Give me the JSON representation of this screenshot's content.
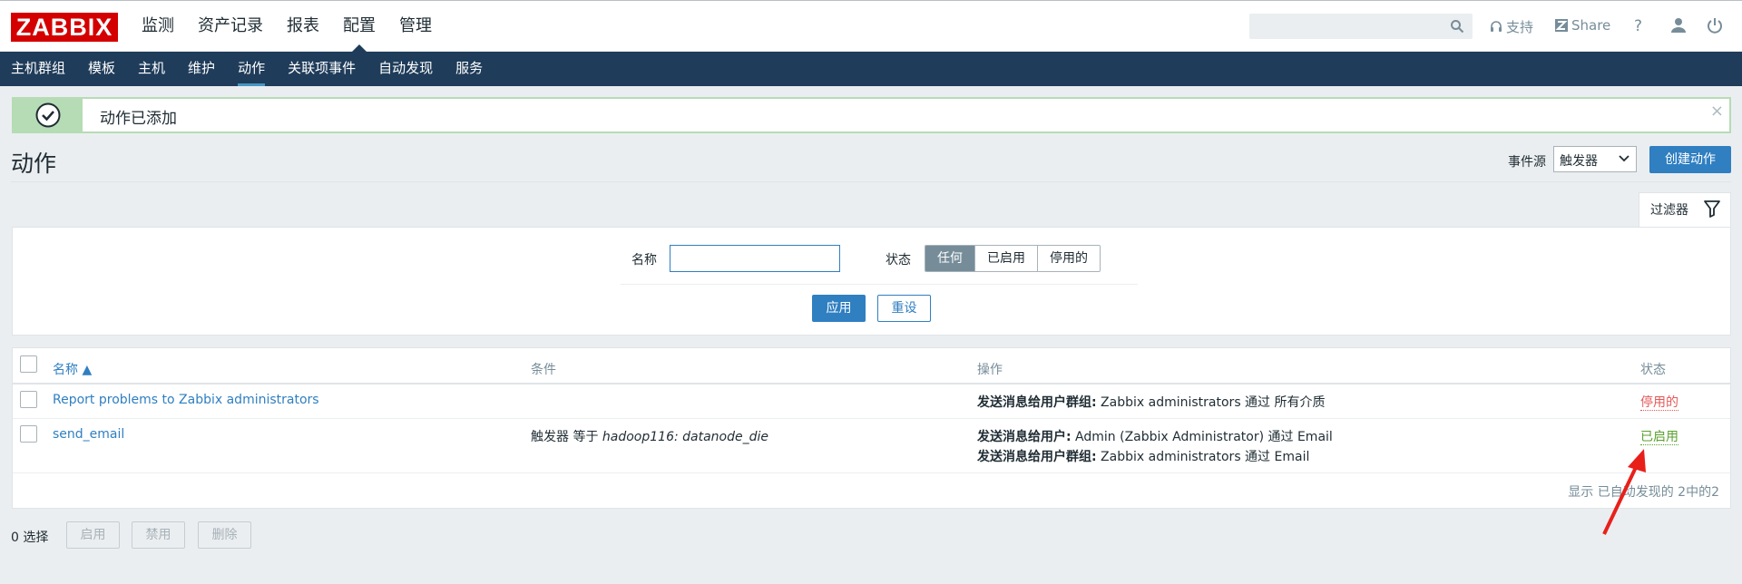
{
  "logo": "ZABBIX",
  "main_menu": [
    "监测",
    "资产记录",
    "报表",
    "配置",
    "管理"
  ],
  "main_menu_active": "配置",
  "header_links": {
    "support": "支持",
    "share": "Share",
    "help": "?"
  },
  "sub_menu": [
    "主机群组",
    "模板",
    "主机",
    "维护",
    "动作",
    "关联项事件",
    "自动发现",
    "服务"
  ],
  "sub_menu_active": "动作",
  "message": {
    "text": "动作已添加",
    "close": "×"
  },
  "page": {
    "title": "动作",
    "event_source_label": "事件源",
    "event_source_value": "触发器",
    "create_button": "创建动作"
  },
  "filter": {
    "tab_label": "过滤器",
    "name_label": "名称",
    "name_value": "",
    "status_label": "状态",
    "status_options": [
      "任何",
      "已启用",
      "停用的"
    ],
    "status_selected": "任何",
    "apply": "应用",
    "reset": "重设"
  },
  "table": {
    "columns": [
      "名称 ▲",
      "条件",
      "操作",
      "状态"
    ],
    "rows": [
      {
        "name": "Report problems to Zabbix administrators",
        "condition": {
          "prefix": "",
          "italic": ""
        },
        "operations": [
          {
            "label": "发送消息给用户群组:",
            "text": " Zabbix administrators 通过 所有介质"
          }
        ],
        "status": "停用的",
        "status_kind": "disabled"
      },
      {
        "name": "send_email",
        "condition": {
          "prefix": "触发器 等于 ",
          "italic": "hadoop116: datanode_die"
        },
        "operations": [
          {
            "label": "发送消息给用户:",
            "text": " Admin (Zabbix Administrator) 通过 Email"
          },
          {
            "label": "发送消息给用户群组:",
            "text": " Zabbix administrators 通过 Email"
          }
        ],
        "status": "已启用",
        "status_kind": "enabled"
      }
    ],
    "footer": "显示 已自动发现的 2中的2"
  },
  "bottom": {
    "selected": "0 选择",
    "enable": "启用",
    "disable": "禁用",
    "delete": "删除"
  },
  "colors": {
    "nav_bg": "#1f3c5a",
    "accent": "#2f7fc1",
    "enabled": "#59a12e",
    "disabled": "#e45959",
    "success_bg": "#b6dcb5",
    "annotation_arrow": "#e8201a"
  }
}
